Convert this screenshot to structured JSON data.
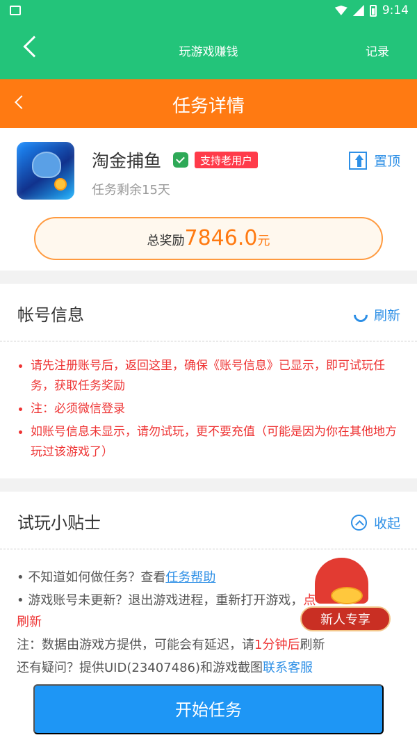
{
  "status": {
    "time": "9:14"
  },
  "app_header": {
    "title": "玩游戏赚钱",
    "record": "记录"
  },
  "sub_header": {
    "title": "任务详情"
  },
  "game": {
    "name": "淘金捕鱼",
    "badge": "支持老用户",
    "days_left": "任务剩余15天",
    "pin_label": "置顶",
    "reward_label": "总奖励",
    "reward_value": "7846.0",
    "reward_unit": "元"
  },
  "account": {
    "title": "帐号信息",
    "refresh": "刷新",
    "items": [
      "请先注册账号后，返回这里，确保《账号信息》已显示，即可试玩任务，获取任务奖励",
      "注：必须微信登录",
      "如账号信息未显示，请勿试玩，更不要充值（可能是因为你在其他地方玩过该游戏了）"
    ]
  },
  "tips": {
    "title": "试玩小贴士",
    "collapse": "收起",
    "line1_prefix": "• 不知道如何做任务？查看",
    "line1_link": "任务帮助",
    "line2_text": "• 游戏账号未更新？退出游戏进程，重新打开游戏，",
    "line2_suffix": "点",
    "line2_red": "刷新",
    "line3_prefix": "注：数据由游戏方提供，可能会有延迟，请",
    "line3_red": "1分钟后",
    "line3_suffix": "刷新",
    "line4_prefix": "还有疑问？提供UID(23407486)和游戏截图",
    "line4_link": "联系客服"
  },
  "promo": {
    "label": "新人专享"
  },
  "bottom": {
    "start_button": "开始任务"
  }
}
